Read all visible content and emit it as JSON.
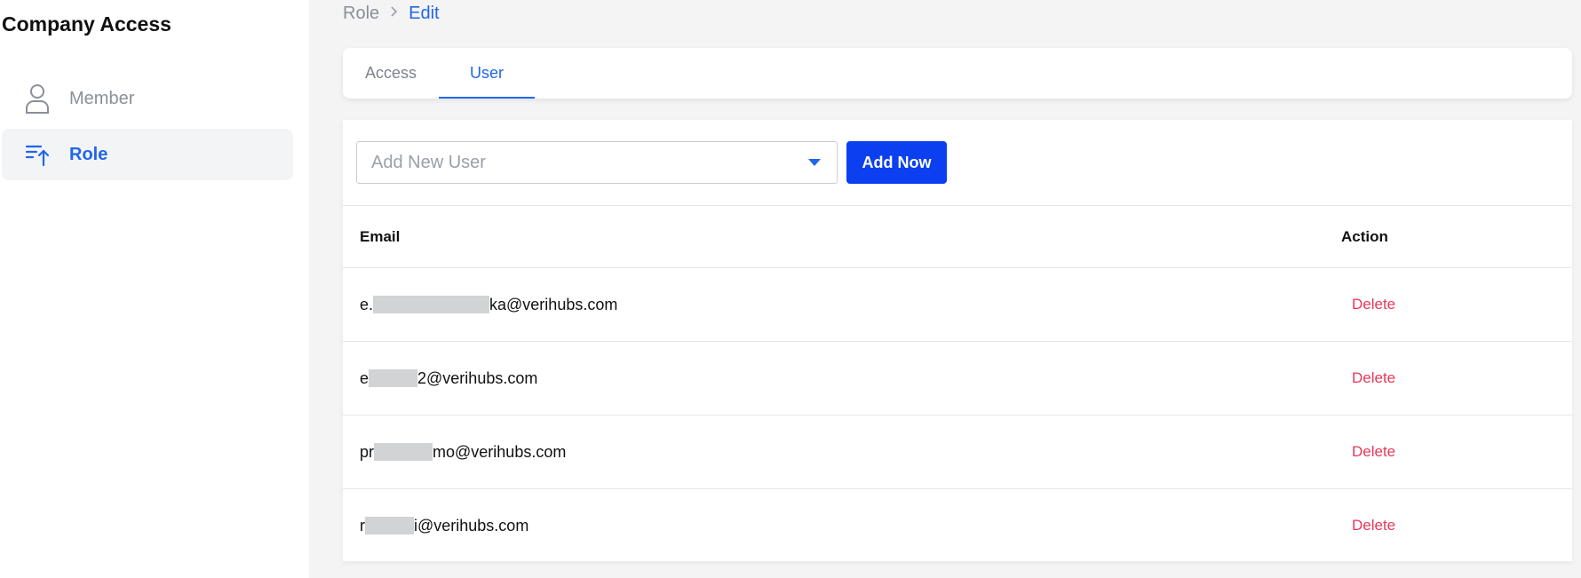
{
  "sidebar": {
    "title": "Company Access",
    "items": [
      {
        "label": "Member",
        "icon": "person-icon",
        "active": false
      },
      {
        "label": "Role",
        "icon": "sort-arrow-up-icon",
        "active": true
      }
    ]
  },
  "breadcrumb": {
    "parent": "Role",
    "separator": ">",
    "current": "Edit"
  },
  "tabs": [
    {
      "label": "Access",
      "active": false
    },
    {
      "label": "User",
      "active": true
    }
  ],
  "add_user": {
    "placeholder": "Add New User",
    "button_label": "Add Now"
  },
  "table": {
    "columns": [
      "Email",
      "Action"
    ],
    "rows": [
      {
        "email_prefix": "e.",
        "email_suffix": "ka@verihubs.com",
        "action": "Delete"
      },
      {
        "email_prefix": "e",
        "email_suffix": "2@verihubs.com",
        "action": "Delete"
      },
      {
        "email_prefix": "pr",
        "email_suffix": "mo@verihubs.com",
        "action": "Delete"
      },
      {
        "email_prefix": "r",
        "email_suffix": "i@verihubs.com",
        "action": "Delete"
      }
    ]
  },
  "colors": {
    "accent": "#2166e8",
    "primary_button": "#0b3ff0",
    "danger": "#e8375a",
    "background": "#f4f4f5"
  }
}
